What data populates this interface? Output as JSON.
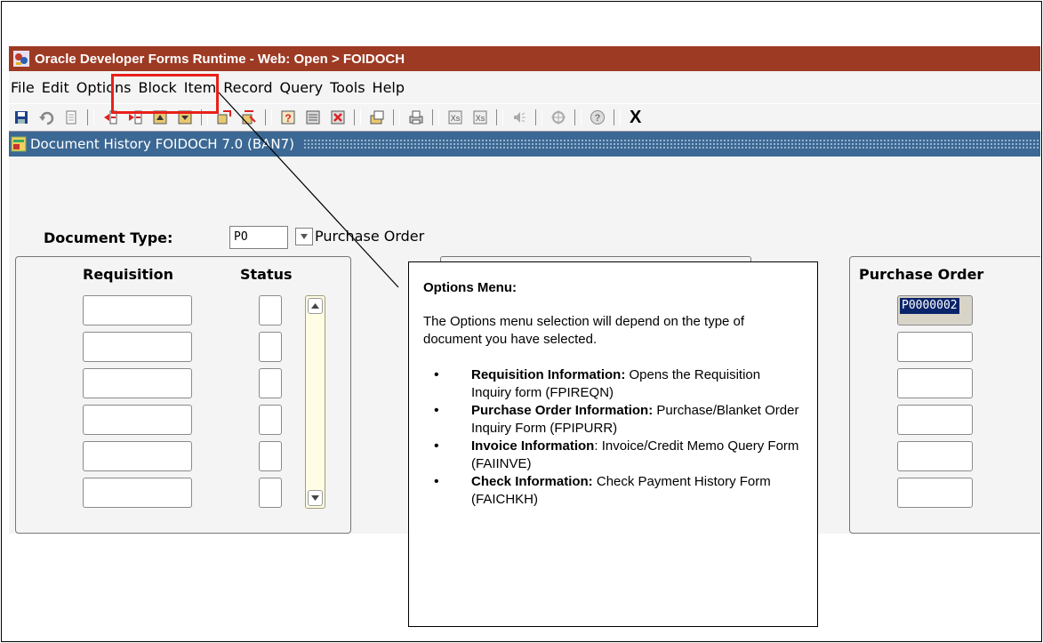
{
  "window": {
    "title": "Oracle Developer Forms Runtime - Web:  Open > FOIDOCH"
  },
  "menu": {
    "items": [
      "File",
      "Edit",
      "Options",
      "Block",
      "Item",
      "Record",
      "Query",
      "Tools",
      "Help"
    ]
  },
  "toolbar": {
    "buttons": [
      "save-icon",
      "rollback-icon",
      "print-icon",
      "insert-record-icon",
      "remove-record-icon",
      "enter-query-icon",
      "execute-query-icon",
      "previous-block-icon",
      "next-block-icon",
      "help-icon",
      "list-values-icon",
      "cancel-query-icon",
      "open-folder-icon",
      "print-report-icon",
      "first-record-icon",
      "last-record-icon",
      "volume-icon",
      "navigate-icon",
      "help-circle-icon"
    ],
    "exit_label": "X"
  },
  "form": {
    "title": "Document History  FOIDOCH  7.0  (BAN7)"
  },
  "document_type": {
    "label": "Document Type:",
    "value": "PO",
    "description": "Purchase Order"
  },
  "requisition": {
    "header": "Requisition",
    "status_header": "Status"
  },
  "purchase_order": {
    "header": "Purchase Order",
    "first_value": "P0000002"
  },
  "callout": {
    "title": "Options Menu:",
    "intro": "The Options menu selection will depend on the type of document you have selected.",
    "items": [
      {
        "label": "Requisition Information:",
        "text": " Opens the Requisition Inquiry form (FPIREQN)"
      },
      {
        "label": "Purchase Order Information:",
        "text": " Purchase/Blanket Order Inquiry Form (FPIPURR)"
      },
      {
        "label": "Invoice Information",
        "text": ": Invoice/Credit Memo Query Form (FAIINVE)"
      },
      {
        "label": "Check Information:",
        "text": " Check Payment History Form (FAICHKH)"
      }
    ]
  },
  "colors": {
    "titlebar": "#9d3a23",
    "formbar": "#3b6894",
    "highlight": "#e8201a",
    "selection": "#0a246a"
  }
}
